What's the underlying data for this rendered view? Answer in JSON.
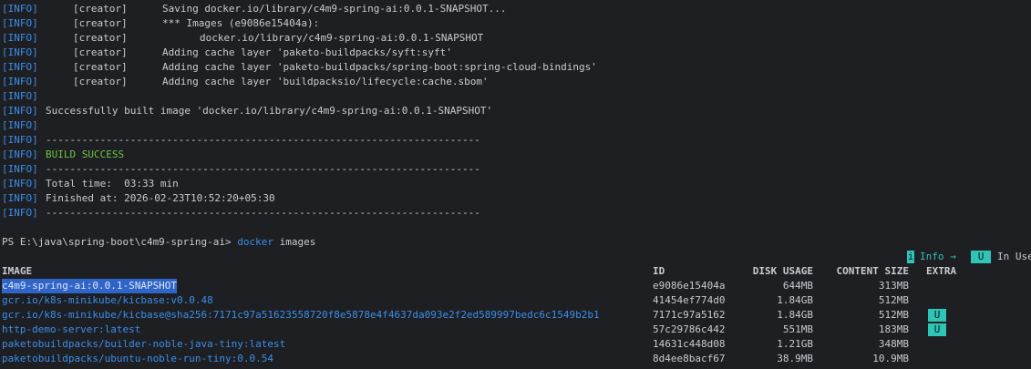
{
  "build_log": [
    {
      "tag": "[INFO]",
      "creator": "[creator]",
      "detail": "Saving docker.io/library/c4m9-spring-ai:0.0.1-SNAPSHOT...",
      "indent": 0
    },
    {
      "tag": "[INFO]",
      "creator": "[creator]",
      "detail": "*** Images (e9086e15404a):",
      "indent": 0
    },
    {
      "tag": "[INFO]",
      "creator": "[creator]",
      "detail": "docker.io/library/c4m9-spring-ai:0.0.1-SNAPSHOT",
      "indent": 1
    },
    {
      "tag": "[INFO]",
      "creator": "[creator]",
      "detail": "Adding cache layer 'paketo-buildpacks/syft:syft'",
      "indent": 0
    },
    {
      "tag": "[INFO]",
      "creator": "[creator]",
      "detail": "Adding cache layer 'paketo-buildpacks/spring-boot:spring-cloud-bindings'",
      "indent": 0
    },
    {
      "tag": "[INFO]",
      "creator": "[creator]",
      "detail": "Adding cache layer 'buildpacksio/lifecycle:cache.sbom'",
      "indent": 0
    }
  ],
  "info_tag": "[INFO]",
  "built_message": "Successfully built image 'docker.io/library/c4m9-spring-ai:0.0.1-SNAPSHOT'",
  "separator": "------------------------------------------------------------------------",
  "build_success": "BUILD SUCCESS",
  "total_time": "Total time:  03:33 min",
  "finished_at": "Finished at: 2026-02-23T10:52:20+05:30",
  "prompt": "PS E:\\java\\spring-boot\\c4m9-spring-ai>",
  "command": "docker",
  "command_args": "images",
  "hint": {
    "info_key": "i",
    "info_label": "Info →",
    "inuse_key": "U",
    "inuse_label": "In Use"
  },
  "table": {
    "headers": {
      "image": "IMAGE",
      "id": "ID",
      "disk": "DISK USAGE",
      "content": "CONTENT SIZE",
      "extra": "EXTRA"
    },
    "rows": [
      {
        "image": "c4m9-spring-ai:0.0.1-SNAPSHOT",
        "id": "e9086e15404a",
        "disk": "644MB",
        "content": "313MB",
        "extra": "",
        "selected": true
      },
      {
        "image": "gcr.io/k8s-minikube/kicbase:v0.0.48",
        "id": "41454ef774d0",
        "disk": "1.84GB",
        "content": "512MB",
        "extra": ""
      },
      {
        "image": "gcr.io/k8s-minikube/kicbase@sha256:7171c97a51623558720f8e5878e4f4637da093e2f2ed589997bedc6c1549b2b1",
        "id": "7171c97a5162",
        "disk": "1.84GB",
        "content": "512MB",
        "extra": "U"
      },
      {
        "image": "http-demo-server:latest",
        "id": "57c29786c442",
        "disk": "551MB",
        "content": "183MB",
        "extra": "U"
      },
      {
        "image": "paketobuildpacks/builder-noble-java-tiny:latest",
        "id": "14631c448d08",
        "disk": "1.21GB",
        "content": "348MB",
        "extra": ""
      },
      {
        "image": "paketobuildpacks/ubuntu-noble-run-tiny:0.0.54",
        "id": "8d4ee8bacf67",
        "disk": "38.9MB",
        "content": "10.9MB",
        "extra": ""
      }
    ]
  }
}
